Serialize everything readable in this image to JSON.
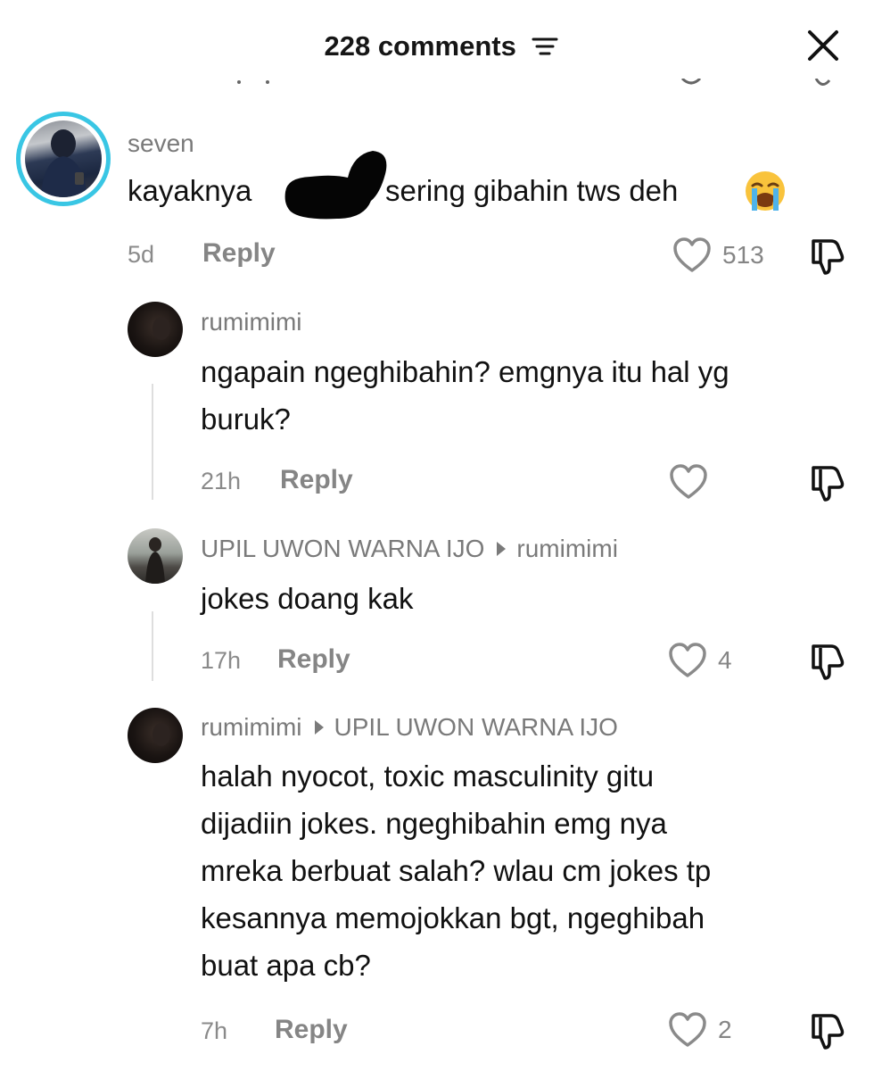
{
  "header": {
    "title": "228 comments",
    "filter_icon": "filter-lines-icon",
    "close_icon": "close-x-icon"
  },
  "colors": {
    "avatar_ring": "#39c6e4",
    "secondary_text": "#858585",
    "primary_text": "#111111"
  },
  "comments": [
    {
      "username": "seven",
      "text_before": "kayaknya",
      "text_after": "sering gibahin tws deh",
      "emoji": "loudly-crying-face",
      "time": "5d",
      "reply_label": "Reply",
      "likes": "513"
    },
    {
      "username": "rumimimi",
      "lines": [
        "ngapain ngeghibahin? emgnya itu hal yg",
        "buruk?"
      ],
      "time": "21h",
      "reply_label": "Reply",
      "likes": ""
    },
    {
      "username": "UPIL UWON WARNA IJO",
      "reply_to": "rumimimi",
      "lines": [
        "jokes doang kak"
      ],
      "time": "17h",
      "reply_label": "Reply",
      "likes": "4"
    },
    {
      "username": "rumimimi",
      "reply_to": "UPIL UWON WARNA IJO",
      "lines": [
        "halah nyocot, toxic masculinity gitu",
        "dijadiin jokes. ngeghibahin emg nya",
        "mreka berbuat salah? wlau cm jokes tp",
        "kesannya memojokkan bgt, ngeghibah",
        "buat apa cb?"
      ],
      "time": "7h",
      "reply_label": "Reply",
      "likes": "2"
    }
  ]
}
